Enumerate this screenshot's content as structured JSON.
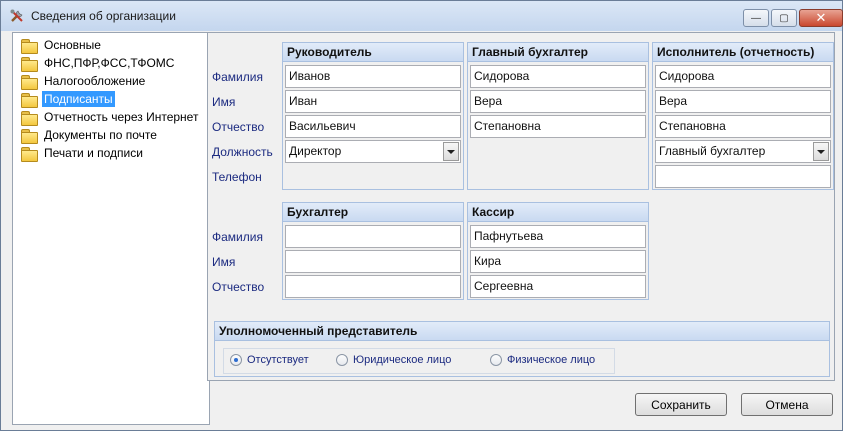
{
  "window": {
    "title": "Сведения об организации",
    "minimize_glyph": "—",
    "maximize_glyph": "▢",
    "close_glyph": "✕"
  },
  "tree": {
    "items": [
      {
        "label": "Основные",
        "selected": false
      },
      {
        "label": "ФНС,ПФР,ФСС,ТФОМС",
        "selected": false
      },
      {
        "label": "Налогообложение",
        "selected": false
      },
      {
        "label": "Подписанты",
        "selected": true
      },
      {
        "label": "Отчетность через Интернет",
        "selected": false
      },
      {
        "label": "Документы по почте",
        "selected": false
      },
      {
        "label": "Печати и подписи",
        "selected": false
      }
    ]
  },
  "labels": {
    "surname": "Фамилия",
    "name": "Имя",
    "patronymic": "Отчество",
    "position": "Должность",
    "phone": "Телефон"
  },
  "director": {
    "title": "Руководитель",
    "surname": "Иванов",
    "name": "Иван",
    "patronymic": "Васильевич",
    "position": "Директор"
  },
  "chief_accountant": {
    "title": "Главный бухгалтер",
    "surname": "Сидорова",
    "name": "Вера",
    "patronymic": "Степановна"
  },
  "executor": {
    "title": "Исполнитель (отчетность)",
    "surname": "Сидорова",
    "name": "Вера",
    "patronymic": "Степановна",
    "position": "Главный бухгалтер",
    "phone": ""
  },
  "accountant": {
    "title": "Бухгалтер",
    "surname": "",
    "name": "",
    "patronymic": ""
  },
  "cashier": {
    "title": "Кассир",
    "surname": "Пафнутьева",
    "name": "Кира",
    "patronymic": "Сергеевна"
  },
  "representative": {
    "title": "Уполномоченный представитель",
    "options": [
      {
        "label": "Отсутствует",
        "checked": true
      },
      {
        "label": "Юридическое лицо",
        "checked": false
      },
      {
        "label": "Физическое лицо",
        "checked": false
      }
    ]
  },
  "buttons": {
    "save": "Сохранить",
    "cancel": "Отмена"
  },
  "colors": {
    "label_text": "#1b2a80",
    "selection": "#3399ff",
    "group_header": "#c9daf1"
  }
}
